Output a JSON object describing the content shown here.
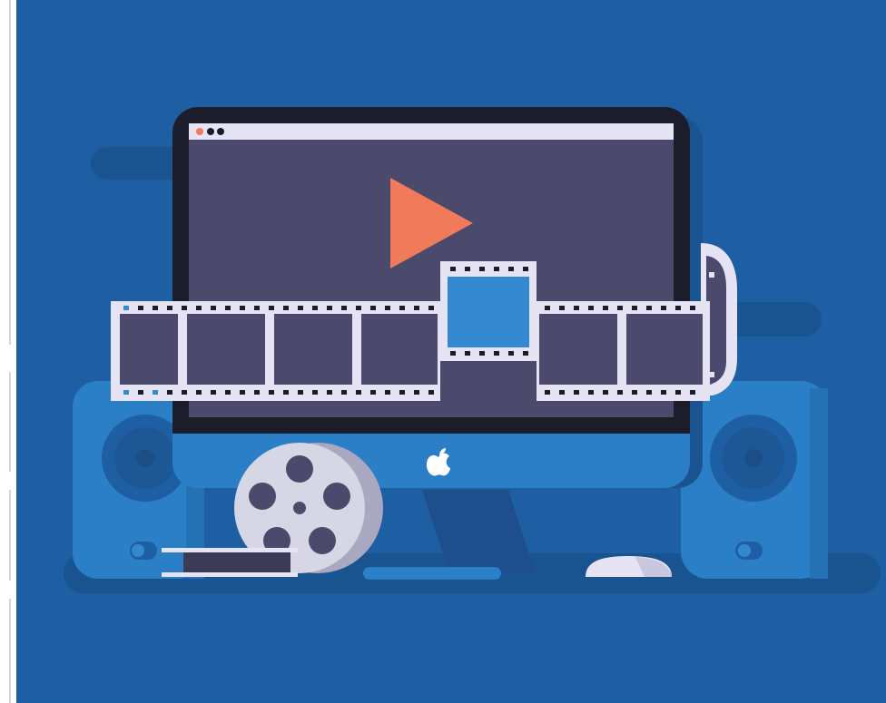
{
  "illustration": {
    "colors": {
      "background": "#1E5FA3",
      "shadow": "#1A5490",
      "monitor_bezel": "#1B1E2A",
      "monitor_body": "#2B7FC6",
      "screen": "#4B4A6C",
      "browser_bar": "#E6E4F4",
      "play_button": "#F07B5A",
      "film_frame": "#E6E4F4",
      "film_cell": "#4B4A6C",
      "film_highlight_cell": "#3388D0",
      "speaker": "#2B7FC6",
      "speaker_cone": "#1E5FA3",
      "reel": "#D7D6E4",
      "reel_shadow": "#A9A8C0",
      "mouse": "#E6E4F4",
      "window_dot_red": "#F07B5A"
    },
    "icons": {
      "play": "play-icon",
      "apple_logo": "apple-logo-icon",
      "film_reel": "film-reel-icon",
      "film_strip": "film-strip-icon",
      "speaker": "speaker-icon",
      "mouse": "mouse-icon"
    }
  }
}
